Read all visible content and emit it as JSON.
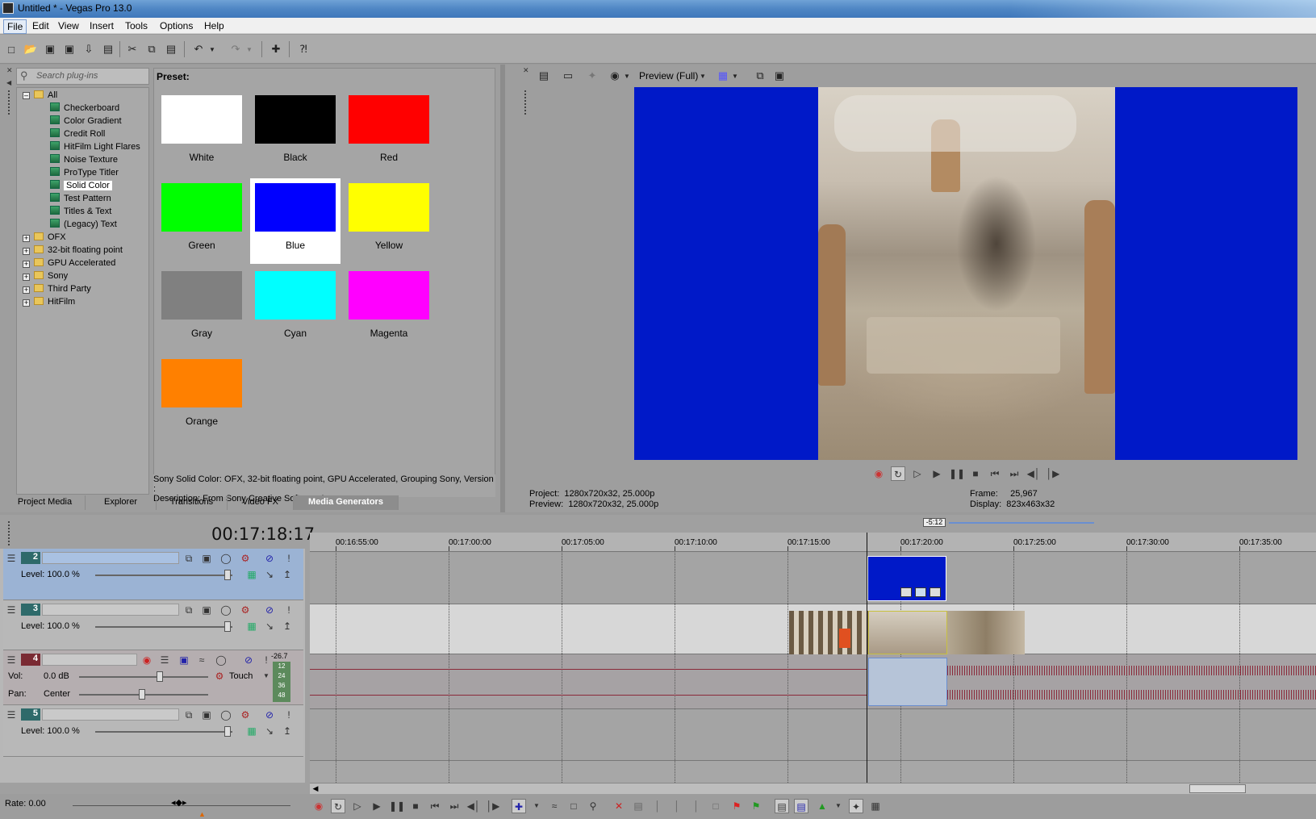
{
  "window": {
    "title": "Untitled * - Vegas Pro 13.0"
  },
  "menu": [
    "File",
    "Edit",
    "View",
    "Insert",
    "Tools",
    "Options",
    "Help"
  ],
  "plugins": {
    "search_placeholder": "Search plug-ins",
    "tree": [
      {
        "label": "All",
        "type": "folder",
        "expanded": true
      },
      {
        "label": "Checkerboard",
        "type": "plugin"
      },
      {
        "label": "Color Gradient",
        "type": "plugin"
      },
      {
        "label": "Credit Roll",
        "type": "plugin"
      },
      {
        "label": "HitFilm Light Flares",
        "type": "plugin"
      },
      {
        "label": "Noise Texture",
        "type": "plugin"
      },
      {
        "label": "ProType Titler",
        "type": "plugin"
      },
      {
        "label": "Solid Color",
        "type": "plugin",
        "selected": true
      },
      {
        "label": "Test Pattern",
        "type": "plugin"
      },
      {
        "label": "Titles & Text",
        "type": "plugin"
      },
      {
        "label": "(Legacy) Text",
        "type": "plugin"
      },
      {
        "label": "OFX",
        "type": "folder"
      },
      {
        "label": "32-bit floating point",
        "type": "folder"
      },
      {
        "label": "GPU Accelerated",
        "type": "folder"
      },
      {
        "label": "Sony",
        "type": "folder"
      },
      {
        "label": "Third Party",
        "type": "folder"
      },
      {
        "label": "HitFilm",
        "type": "folder"
      }
    ]
  },
  "presets": {
    "label": "Preset:",
    "items": [
      {
        "name": "White",
        "color": "#ffffff"
      },
      {
        "name": "Black",
        "color": "#000000"
      },
      {
        "name": "Red",
        "color": "#ff0000"
      },
      {
        "name": "Green",
        "color": "#00ff00"
      },
      {
        "name": "Blue",
        "color": "#0000ff",
        "selected": true
      },
      {
        "name": "Yellow",
        "color": "#ffff00"
      },
      {
        "name": "Gray",
        "color": "#808080"
      },
      {
        "name": "Cyan",
        "color": "#00ffff"
      },
      {
        "name": "Magenta",
        "color": "#ff00ff"
      },
      {
        "name": "Orange",
        "color": "#ff8000"
      }
    ],
    "description_line1": "Sony Solid Color: OFX, 32-bit floating point, GPU Accelerated, Grouping Sony, Version :",
    "description_line2": "Description: From Sony Creative Software Inc."
  },
  "tabs": [
    {
      "label": "Project Media"
    },
    {
      "label": "Explorer"
    },
    {
      "label": "Transitions"
    },
    {
      "label": "Video FX"
    },
    {
      "label": "Media Generators",
      "active": true
    }
  ],
  "preview": {
    "mode": "Preview (Full)",
    "project_label": "Project:",
    "project_value": "1280x720x32, 25.000p",
    "preview_label": "Preview:",
    "preview_value": "1280x720x32, 25.000p",
    "frame_label": "Frame:",
    "frame_value": "25,967",
    "display_label": "Display:",
    "display_value": "823x463x32",
    "bg_color": "#0019c8"
  },
  "timeline": {
    "timecode": "00:17:18:17",
    "ruler": [
      "00:16:55:00",
      "00:17:00:00",
      "00:17:05:00",
      "00:17:10:00",
      "00:17:15:00",
      "00:17:20:00",
      "00:17:25:00",
      "00:17:30:00",
      "00:17:35:00"
    ],
    "rate_badge": "-5:12",
    "tracks": [
      {
        "number": "2",
        "level_label": "Level: 100.0 %"
      },
      {
        "number": "3",
        "level_label": "Level: 100.0 %"
      },
      {
        "number": "4",
        "vol_label": "Vol:",
        "vol_value": "0.0 dB",
        "pan_label": "Pan:",
        "pan_value": "Center",
        "touch": "Touch",
        "meter_top": "-26.7",
        "meter_ticks": [
          "12",
          "24",
          "36",
          "48"
        ]
      },
      {
        "number": "5",
        "level_label": "Level: 100.0 %"
      }
    ],
    "rate": "Rate: 0.00"
  },
  "colors": {
    "accent": "#0019c8",
    "audio_wave": "#8a2a3a"
  }
}
